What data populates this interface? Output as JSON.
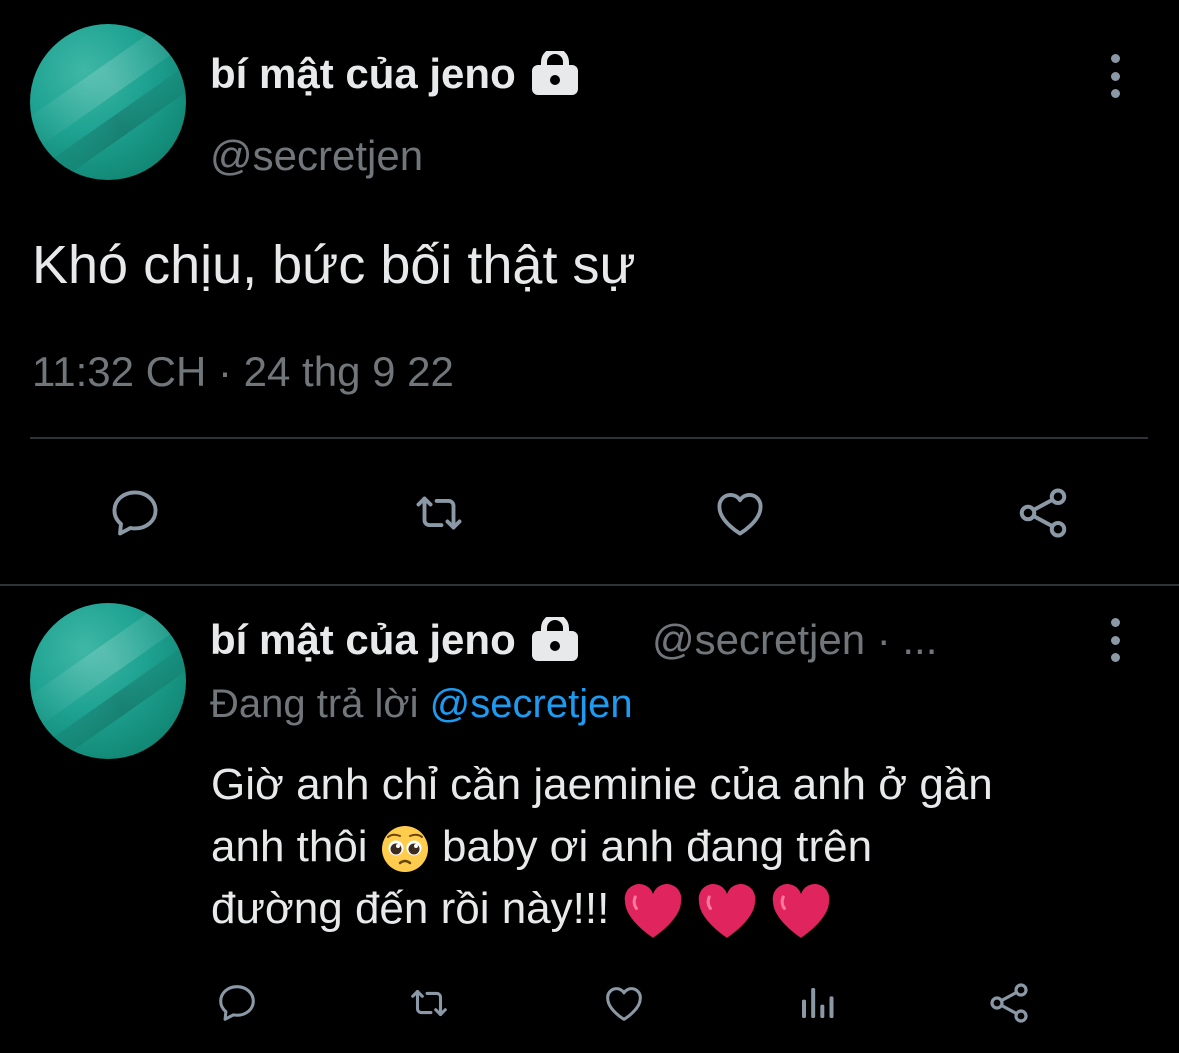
{
  "main_tweet": {
    "display_name": "bí mật của jeno",
    "handle": "@secretjen",
    "text": "Khó chịu, bức bối thật sự",
    "time": "11:32 CH",
    "separator": "·",
    "date": "24 thg 9 22",
    "icons": [
      "lock-icon",
      "more-icon",
      "reply-icon",
      "retweet-icon",
      "like-icon",
      "share-icon"
    ]
  },
  "reply_tweet": {
    "display_name": "bí mật của jeno",
    "handle": "@secretjen",
    "handle_suffix": "· ...",
    "replying_label": "Đang trả lời",
    "replying_to": "@secretjen",
    "text_line1": "Giờ anh chỉ cần jaeminie của anh ở gần",
    "text_line2_a": "anh thôi",
    "text_line2_b": "baby ơi anh đang trên",
    "text_line3": "đường đến rồi này!!!",
    "icons": [
      "lock-icon",
      "more-icon",
      "pleading-face-emoji",
      "heart-emoji",
      "reply-icon",
      "retweet-icon",
      "like-icon",
      "analytics-icon",
      "share-icon"
    ]
  },
  "colors": {
    "background": "#000000",
    "text": "#e7e9ea",
    "muted": "#71767b",
    "link": "#1d9bf0",
    "divider": "#2f3336",
    "icon": "#8b98a5",
    "heart": "#e0245e"
  }
}
